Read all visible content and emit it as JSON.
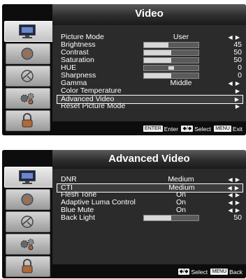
{
  "video_menu": {
    "title": "Video",
    "items": [
      {
        "label": "Picture Mode",
        "value": "User",
        "arrows": "◀ ▶"
      },
      {
        "label": "Brightness",
        "value": "45",
        "level": 0.45
      },
      {
        "label": "Contrast",
        "value": "50",
        "level": 0.5
      },
      {
        "label": "Saturation",
        "value": "50",
        "level": 0.5
      },
      {
        "label": "HUE",
        "value": "0",
        "level": 0.5
      },
      {
        "label": "Sharpness",
        "value": "0",
        "level": 0.5
      },
      {
        "label": "Gamma",
        "value": "Middle",
        "arrows": "◀ ▶"
      },
      {
        "label": "Color Temperature",
        "arrows": "▶"
      },
      {
        "label": "Advanced Video",
        "arrows": "▶"
      },
      {
        "label": "Reset Picture Mode",
        "arrows": "▶"
      }
    ],
    "footer": {
      "key1": "ENTER",
      "text1": "Enter",
      "key2": "◆/◆",
      "text2": "Select",
      "key3": "MENU",
      "text3": "Exit"
    }
  },
  "advanced_menu": {
    "title": "Advanced Video",
    "items": [
      {
        "label": "DNR",
        "value": "Medium",
        "arrows": "◀ ▶"
      },
      {
        "label": "CTI",
        "value": "Medium",
        "arrows": "◀ ▶"
      },
      {
        "label": "Flesh Tone",
        "value": "On",
        "arrows": "◀ ▶"
      },
      {
        "label": "Adaptive Luma Control",
        "value": "On",
        "arrows": "◀ ▶"
      },
      {
        "label": "Blue Mute",
        "value": "On",
        "arrows": "◀ ▶"
      },
      {
        "label": "Back Light",
        "value": "50",
        "level": 0.5
      }
    ],
    "footer": {
      "key2": "◆/◆",
      "text2": "Select",
      "key3": "MENU",
      "text3": "Back"
    }
  },
  "icons": [
    "monitor-icon",
    "speaker-icon",
    "satellite-dish-icon",
    "gears-icon",
    "padlock-icon"
  ],
  "colors": {
    "menu_bg": "#2b2b2b",
    "outer_bg": "#0d0d0d",
    "text": "#ffffff",
    "bar_fill": "#d8d8d8"
  }
}
